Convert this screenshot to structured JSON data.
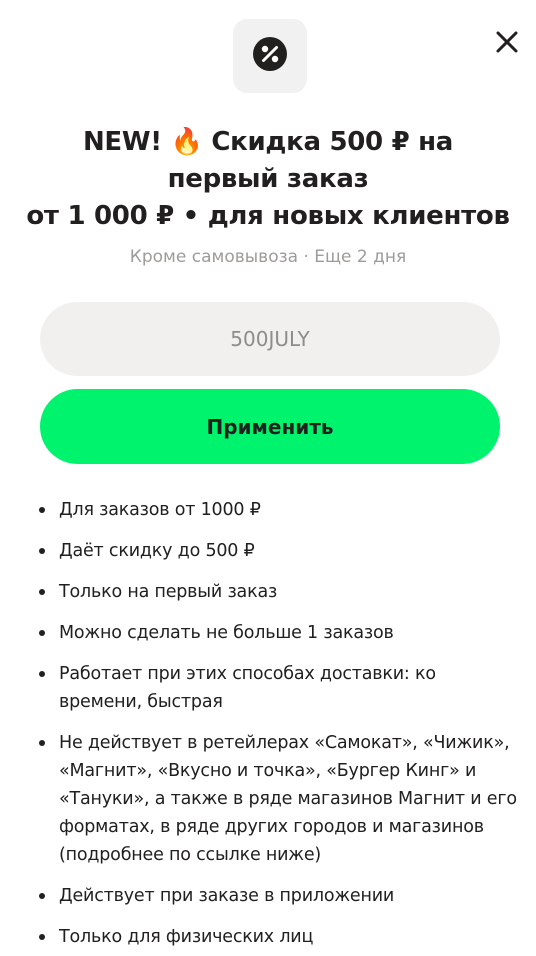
{
  "promo": {
    "title_line1": "NEW! 🔥 Скидка 500 ₽ на",
    "title_line2": "первый заказ",
    "title_line3": "от 1 000 ₽ • для новых клиентов",
    "subtitle": "Кроме самовывоза · Еще 2 дня",
    "code_placeholder": "500JULY",
    "apply_label": "Применить",
    "conditions": [
      "Для заказов от 1000 ₽",
      "Даёт скидку до 500 ₽",
      "Только на первый заказ",
      "Можно сделать не больше 1 заказов",
      "Работает при этих способах доставки: ко времени, быстрая",
      "Не действует в ретейлерах «Самокат», «Чижик», «Магнит», «Вкусно и точка», «Бургер Кинг» и «Тануки», а также в ряде магазинов Магнит и его форматах, в ряде других городов и магазинов (подробнее по ссылке ниже)",
      "Действует при заказе в приложении",
      "Только для физических лиц"
    ]
  },
  "icons": {
    "promo": "percent-icon",
    "close": "close-icon"
  },
  "colors": {
    "accent": "#00f36c",
    "text": "#21201f",
    "muted": "#9e9b98",
    "input_bg": "#f1f0ef",
    "icon_bg": "#f1f1f1"
  }
}
